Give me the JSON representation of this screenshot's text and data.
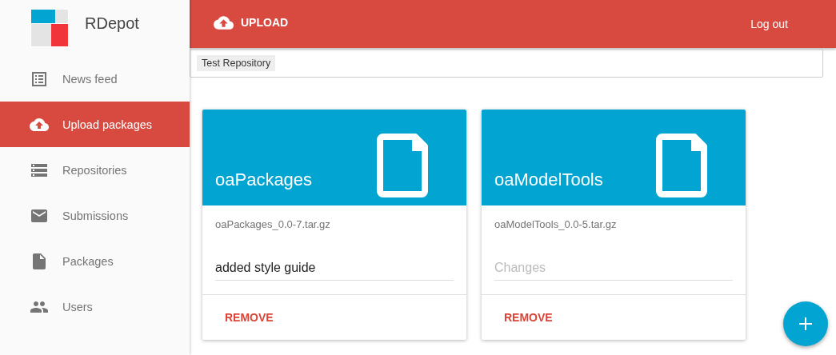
{
  "app": {
    "name": "RDepot"
  },
  "sidebar": {
    "items": [
      {
        "label": "News feed",
        "kind": "list",
        "selected": false
      },
      {
        "label": "Upload packages",
        "kind": "upload",
        "selected": true
      },
      {
        "label": "Repositories",
        "kind": "storage",
        "selected": false
      },
      {
        "label": "Submissions",
        "kind": "mail",
        "selected": false
      },
      {
        "label": "Packages",
        "kind": "file",
        "selected": false
      },
      {
        "label": "Users",
        "kind": "people",
        "selected": false
      }
    ]
  },
  "toolbar": {
    "title": "UPLOAD",
    "logout": "Log out"
  },
  "repository_field": {
    "chips": [
      "Test Repository"
    ]
  },
  "packages": [
    {
      "name": "oaPackages",
      "file": "oaPackages_0.0-7.tar.gz",
      "changes": {
        "value": "added style guide"
      },
      "action": "REMOVE"
    },
    {
      "name": "oaModelTools",
      "file": "oaModelTools_0.0-5.tar.gz",
      "changes": {
        "placeholder": "Changes"
      },
      "action": "REMOVE"
    }
  ]
}
